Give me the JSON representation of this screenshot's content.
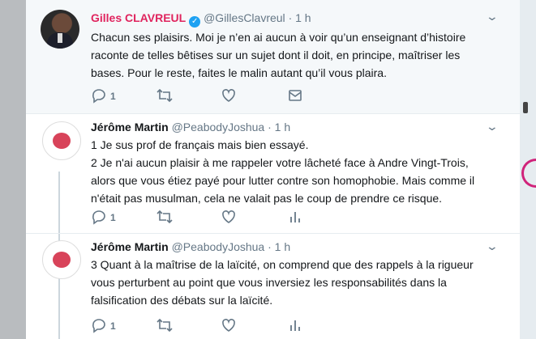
{
  "tweets": {
    "main": {
      "author": "Gilles CLAVREUL",
      "handle": "@GillesClavreul",
      "separator": "·",
      "time": "1 h",
      "text_lines": [
        "Chacun ses plaisirs. Moi je n’en ai aucun à voir qu’un enseignant d’histoire",
        "raconte de telles bêtises sur un sujet dont il doit, en principe, maîtriser les",
        "bases. Pour le reste, faites le malin autant qu’il vous plaira."
      ],
      "reply_count": "1"
    },
    "reply1": {
      "author": "Jérôme Martin",
      "handle": "@PeabodyJoshua",
      "separator": "·",
      "time": "1 h",
      "text_lines": [
        "1 Je sus prof de français mais bien essayé.",
        "2 Je n'ai aucun plaisir à me rappeler votre lâcheté face à Andre Vingt-Trois,",
        "alors que vous étiez payé pour lutter contre son homophobie. Mais comme il",
        "n'était pas musulman, cela ne valait pas le coup de prendre ce risque."
      ],
      "reply_count": "1"
    },
    "reply2": {
      "author": "Jérôme Martin",
      "handle": "@PeabodyJoshua",
      "separator": "·",
      "time": "1 h",
      "text_lines": [
        "3 Quant à la maîtrise de la laïcité, on comprend que des rappels à la rigueur",
        "vous perturbent au point que vous inversiez les responsabilités dans la",
        "falsification des débats sur la laïcité."
      ],
      "reply_count": "1"
    }
  },
  "icons": [
    "reply-icon",
    "retweet-icon",
    "like-icon",
    "message-icon",
    "analytics-icon",
    "chevron-down-icon",
    "verified-icon"
  ],
  "colors": {
    "accent": "#1da1f2",
    "author_highlight": "#e0245e",
    "secondary_text": "#657786"
  }
}
